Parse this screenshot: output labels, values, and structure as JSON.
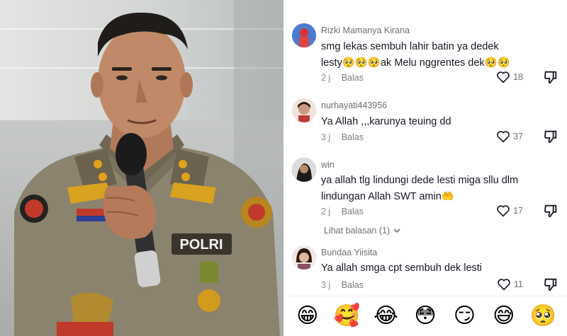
{
  "comments": [
    {
      "username": "Rizki Mamanya Kirana",
      "line1": "smg lekas sembuh lahir batin ya dedek",
      "line2": "lesty🥺🥺🥺ak Melu nggrentes dek🥺🥺",
      "age": "2 j",
      "reply_label": "Balas",
      "likes": "18"
    },
    {
      "username": "nurhayati443956",
      "line1": "Ya Allah ,,,karunya teuing dd",
      "line2": "",
      "age": "3 j",
      "reply_label": "Balas",
      "likes": "37"
    },
    {
      "username": "win",
      "line1": "ya allah tlg lindungi dede lesti miga sllu dlm",
      "line2": "lindungan Allah SWT amin🤲",
      "age": "2 j",
      "reply_label": "Balas",
      "likes": "17",
      "view_replies": "Lihat balasan (1)"
    },
    {
      "username": "Bundaa Yiisita",
      "line1": "Ya allah smga cpt sembuh dek lesti",
      "line2": "",
      "age": "3 j",
      "reply_label": "Balas",
      "likes": "11"
    }
  ],
  "video": {
    "badge_text": "POLRI"
  },
  "emoji_bar": [
    "😁",
    "🥰",
    "😂",
    "😳",
    "😏",
    "😅",
    "🥺"
  ],
  "icons": {
    "like": "heart-outline-icon",
    "dislike": "thumb-down-outline-icon",
    "expand": "chevron-down-icon"
  },
  "colors": {
    "text": "#161823",
    "muted": "#8a8b91",
    "username": "#6e6e6e"
  }
}
